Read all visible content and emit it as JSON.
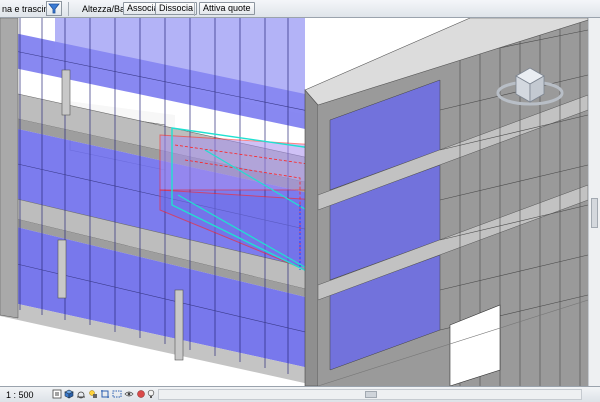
{
  "toolbar": {
    "drag_label": "na e trascina",
    "height_base_label": "Altezza/Base:",
    "associate_label": "Associa",
    "dissociate_label": "Dissocia",
    "activate_dims_label": "Attiva quote"
  },
  "status": {
    "scale": "1 : 500"
  },
  "colors": {
    "glass": "#7070ee",
    "glass_dark": "#4a4ad8",
    "wall": "#b3b3b3",
    "wall_dark": "#8c8c8c",
    "slab_top": "#d8d8d8",
    "highlight_red": "#ff2020",
    "highlight_cyan": "#20e0d0"
  },
  "icons": [
    "filter-icon",
    "view-cube-icon",
    "detail-level-icon",
    "visual-style-icon",
    "sun-path-icon",
    "shadows-icon",
    "crop-view-icon",
    "show-crop-icon",
    "temp-hide-icon",
    "reveal-hidden-icon",
    "analysis-icon"
  ]
}
